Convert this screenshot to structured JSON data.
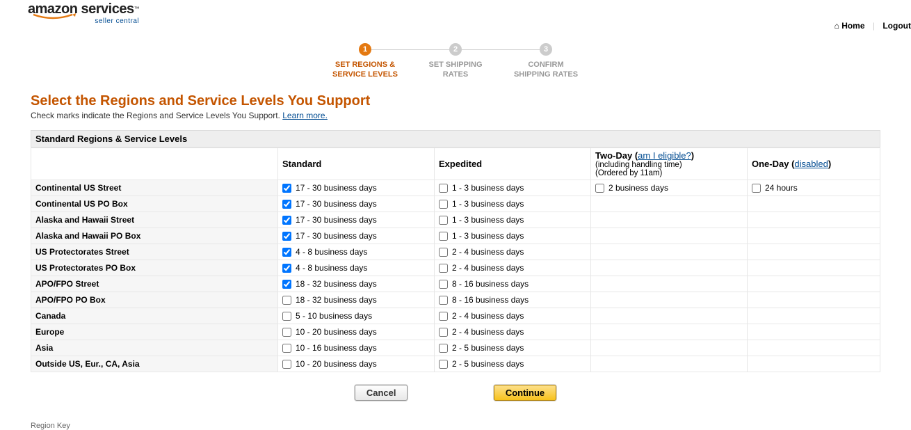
{
  "logo": {
    "text": "amazon services",
    "sub": "seller central"
  },
  "topnav": {
    "home": "Home",
    "logout": "Logout"
  },
  "steps": [
    {
      "num": "1",
      "line1": "SET REGIONS &",
      "line2": "SERVICE LEVELS",
      "active": true
    },
    {
      "num": "2",
      "line1": "SET SHIPPING",
      "line2": "RATES",
      "active": false
    },
    {
      "num": "3",
      "line1": "CONFIRM",
      "line2": "SHIPPING RATES",
      "active": false
    }
  ],
  "page": {
    "title": "Select the Regions and Service Levels You Support",
    "subtitle": "Check marks indicate the Regions and Service Levels You Support. ",
    "learn_more": "Learn more."
  },
  "section_bar": "Standard Regions & Service Levels",
  "columns": {
    "standard": "Standard",
    "expedited": "Expedited",
    "twoday": {
      "label": "Two-Day",
      "eligible_link": "am I eligible?",
      "sub1": "(including handling time)",
      "sub2": "(Ordered by 11am)"
    },
    "oneday": {
      "label": "One-Day",
      "status_link": "disabled"
    }
  },
  "rows": [
    {
      "name": "Continental US Street",
      "standard": {
        "checked": true,
        "text": "17 - 30 business days"
      },
      "expedited": {
        "checked": false,
        "text": "1 - 3 business days"
      },
      "twoday": {
        "checked": false,
        "text": "2 business days"
      },
      "oneday": {
        "checked": false,
        "text": "24 hours"
      }
    },
    {
      "name": "Continental US PO Box",
      "standard": {
        "checked": true,
        "text": "17 - 30 business days"
      },
      "expedited": {
        "checked": false,
        "text": "1 - 3 business days"
      }
    },
    {
      "name": "Alaska and Hawaii Street",
      "standard": {
        "checked": true,
        "text": "17 - 30 business days"
      },
      "expedited": {
        "checked": false,
        "text": "1 - 3 business days"
      }
    },
    {
      "name": "Alaska and Hawaii PO Box",
      "standard": {
        "checked": true,
        "text": "17 - 30 business days"
      },
      "expedited": {
        "checked": false,
        "text": "1 - 3 business days"
      }
    },
    {
      "name": "US Protectorates Street",
      "standard": {
        "checked": true,
        "text": "4 - 8 business days"
      },
      "expedited": {
        "checked": false,
        "text": "2 - 4 business days"
      }
    },
    {
      "name": "US Protectorates PO Box",
      "standard": {
        "checked": true,
        "text": "4 - 8 business days"
      },
      "expedited": {
        "checked": false,
        "text": "2 - 4 business days"
      }
    },
    {
      "name": "APO/FPO Street",
      "standard": {
        "checked": true,
        "text": "18 - 32 business days"
      },
      "expedited": {
        "checked": false,
        "text": "8 - 16 business days"
      }
    },
    {
      "name": "APO/FPO PO Box",
      "standard": {
        "checked": false,
        "text": "18 - 32 business days"
      },
      "expedited": {
        "checked": false,
        "text": "8 - 16 business days"
      }
    },
    {
      "name": "Canada",
      "standard": {
        "checked": false,
        "text": "5 - 10 business days"
      },
      "expedited": {
        "checked": false,
        "text": "2 - 4 business days"
      }
    },
    {
      "name": "Europe",
      "standard": {
        "checked": false,
        "text": "10 - 20 business days"
      },
      "expedited": {
        "checked": false,
        "text": "2 - 4 business days"
      }
    },
    {
      "name": "Asia",
      "standard": {
        "checked": false,
        "text": "10 - 16 business days"
      },
      "expedited": {
        "checked": false,
        "text": "2 - 5 business days"
      }
    },
    {
      "name": "Outside US, Eur., CA, Asia",
      "standard": {
        "checked": false,
        "text": "10 - 20 business days"
      },
      "expedited": {
        "checked": false,
        "text": "2 - 5 business days"
      }
    }
  ],
  "buttons": {
    "cancel": "Cancel",
    "continue": "Continue"
  },
  "region_key": "Region Key"
}
